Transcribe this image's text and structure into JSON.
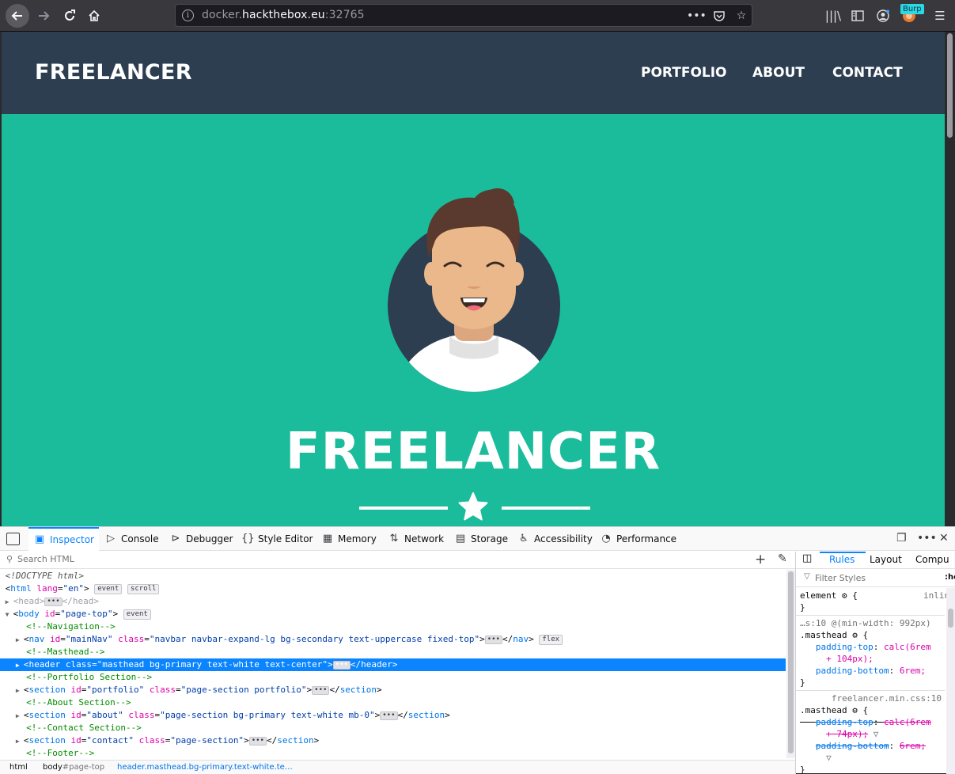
{
  "browser": {
    "url_prefix": "docker.",
    "url_host": "hackthebox.eu",
    "url_port": ":32765",
    "burp_badge": "Burp"
  },
  "site": {
    "brand": "FREELANCER",
    "nav": [
      "PORTFOLIO",
      "ABOUT",
      "CONTACT"
    ],
    "masthead_title": "FREELANCER",
    "colors": {
      "nav_bg": "#2c3e50",
      "masthead_bg": "#1abc9c"
    }
  },
  "devtools": {
    "tabs": [
      "Inspector",
      "Console",
      "Debugger",
      "Style Editor",
      "Memory",
      "Network",
      "Storage",
      "Accessibility",
      "Performance"
    ],
    "search_placeholder": "Search HTML",
    "markup": {
      "doctype": "<!DOCTYPE html>",
      "html_open": "html",
      "html_attr": "lang",
      "html_val": "\"en\"",
      "badge_event": "event",
      "badge_scroll": "scroll",
      "badge_flex": "flex",
      "head": "head",
      "body_open": "body",
      "body_attr": "id",
      "body_val": "\"page-top\"",
      "c_navigation": "<!--Navigation-->",
      "nav_tag": "nav",
      "nav_id": "\"mainNav\"",
      "nav_class": "\"navbar navbar-expand-lg bg-secondary text-uppercase fixed-top\"",
      "c_masthead": "<!--Masthead-->",
      "header_tag": "header",
      "header_class": "\"masthead bg-primary text-white text-center\"",
      "c_portfolio": "<!--Portfolio Section-->",
      "section_tag": "section",
      "portfolio_id": "\"portfolio\"",
      "portfolio_class": "\"page-section portfolio\"",
      "c_about": "<!--About Section-->",
      "about_id": "\"about\"",
      "about_class": "\"page-section bg-primary text-white mb-0\"",
      "c_contact": "<!--Contact Section-->",
      "contact_id": "\"contact\"",
      "contact_class": "\"page-section\"",
      "c_footer": "<!--Footer-->"
    },
    "breadcrumbs": {
      "html": "html",
      "body": "body",
      "body_id": "#page-top",
      "header": "header.masthead.bg-primary.text-white.te…"
    },
    "rules_tabs": [
      "Rules",
      "Layout",
      "Compu"
    ],
    "hover_toggle": ":ho",
    "filter_placeholder": "Filter Styles",
    "rules": {
      "element_selector": "element",
      "element_source": "inline",
      "media_source": "…s:10 @(min-width: 992px)",
      "masthead_selector": ".masthead",
      "pt_prop": "padding-top",
      "pt_val_1": "calc(6rem",
      "pt_val_2": "+ 104px);",
      "pb_prop": "padding-bottom",
      "pb_val": "6rem;",
      "source_2": "freelancer.min.css:10",
      "pt_val_old_1": "calc(6rem",
      "pt_val_old_2": "+ 74px);",
      "pb_val_old": "6rem;"
    }
  }
}
